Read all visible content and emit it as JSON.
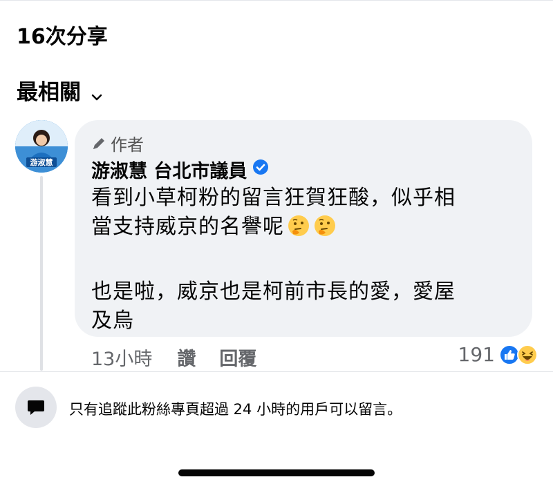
{
  "shares": {
    "label": "16次分享"
  },
  "sort": {
    "label": "最相關"
  },
  "comment": {
    "author_badge": "作者",
    "author_name": "游淑慧 台北市議員",
    "avatar_caption": "游淑慧",
    "lines": [
      "看到小草柯粉的留言狂賀狂酸，似乎相",
      "當支持威京的名譽呢",
      "也是啦，威京也是柯前市長的愛，愛屋",
      "及烏"
    ],
    "emojis": [
      "thinking-face",
      "thinking-face"
    ],
    "time": "13小時",
    "like_action": "讚",
    "reply_action": "回覆",
    "reaction_count": "191",
    "reactions": [
      "like",
      "haha"
    ]
  },
  "notice": {
    "text": "只有追蹤此粉絲專頁超過 24 小時的用戶可以留言。"
  },
  "colors": {
    "accent": "#1877f2",
    "bubble": "#f0f2f5",
    "secondary_text": "#65676b"
  }
}
